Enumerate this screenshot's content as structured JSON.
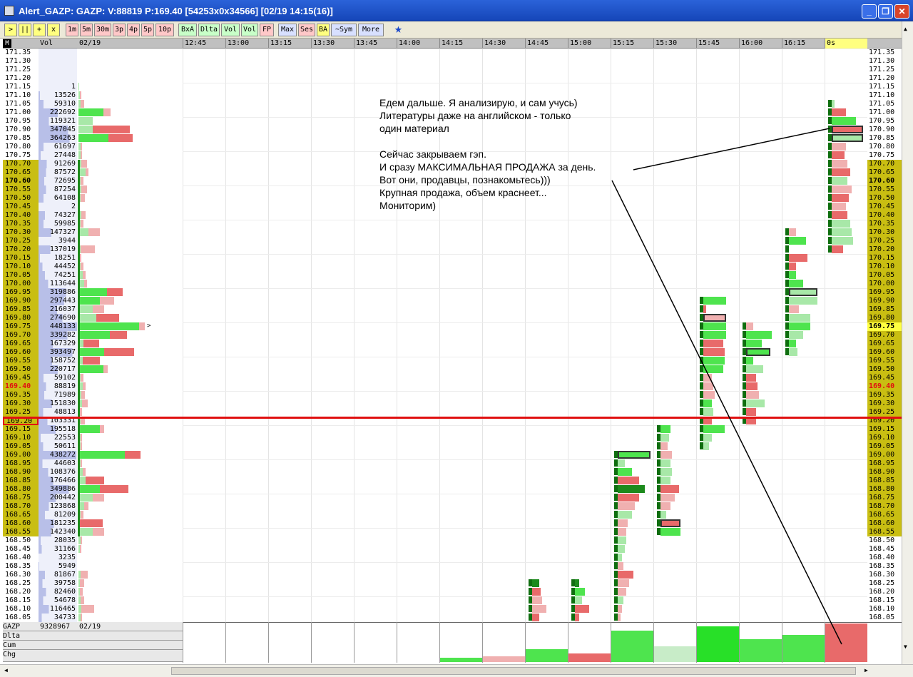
{
  "window": {
    "title": "Alert_GAZP: GAZP: V:88819 P:169.40 [54253x0x34566] [02/19 14:15(16)]",
    "min_label": "_",
    "max_label": "❐",
    "close_label": "✕"
  },
  "toolbar": {
    "buttons": [
      ">",
      "||",
      "+",
      "x",
      "1m",
      "5m",
      "30m",
      "3p",
      "4p",
      "5p",
      "10p",
      "BxA",
      "Dlta",
      "Vol",
      "Vol",
      "FP",
      "Max",
      "Ses",
      "BA",
      "~Sym",
      "More"
    ]
  },
  "left_header": {
    "m": "M",
    "vol": "Vol",
    "date": "02/19"
  },
  "time_labels": [
    "12:45",
    "13:00",
    "13:15",
    "13:30",
    "13:45",
    "14:00",
    "14:15",
    "14:30",
    "14:45",
    "15:00",
    "15:15",
    "15:30",
    "15:45",
    "16:00",
    "16:15",
    "0s"
  ],
  "prices": [
    "171.35",
    "171.30",
    "171.25",
    "171.20",
    "171.15",
    "171.10",
    "171.05",
    "171.00",
    "170.95",
    "170.90",
    "170.85",
    "170.80",
    "170.75",
    "170.70",
    "170.65",
    "170.60",
    "170.55",
    "170.50",
    "170.45",
    "170.40",
    "170.35",
    "170.30",
    "170.25",
    "170.20",
    "170.15",
    "170.10",
    "170.05",
    "170.00",
    "169.95",
    "169.90",
    "169.85",
    "169.80",
    "169.75",
    "169.70",
    "169.65",
    "169.60",
    "169.55",
    "169.50",
    "169.45",
    "169.40",
    "169.35",
    "169.30",
    "169.25",
    "169.20",
    "169.15",
    "169.10",
    "169.05",
    "169.00",
    "168.95",
    "168.90",
    "168.85",
    "168.80",
    "168.75",
    "168.70",
    "168.65",
    "168.60",
    "168.55",
    "168.50",
    "168.45",
    "168.40",
    "168.35",
    "168.30",
    "168.25",
    "168.20",
    "168.15",
    "168.10",
    "168.05"
  ],
  "volumes": [
    "",
    "",
    "",
    "",
    "1",
    "13526",
    "59310",
    "222692",
    "119321",
    "347045",
    "364263",
    "61697",
    "27448",
    "91269",
    "87572",
    "72695",
    "87254",
    "64108",
    "2",
    "74327",
    "59985",
    "147327",
    "3944",
    "137019",
    "18251",
    "44452",
    "74251",
    "113644",
    "319886",
    "297443",
    "216037",
    "274690",
    "448133",
    "339282",
    "167329",
    "393497",
    "158752",
    "220717",
    "59102",
    "88819",
    "71989",
    "151830",
    "48813",
    "103331",
    "195518",
    "22553",
    "50611",
    "438272",
    "44603",
    "108376",
    "176466",
    "349886",
    "200442",
    "123868",
    "81209",
    "181235",
    "142340",
    "28035",
    "31166",
    "3235",
    "5949",
    "81867",
    "39758",
    "82460",
    "54678",
    "116465",
    "34733"
  ],
  "current_price": "169.40",
  "bold_price": "170.60",
  "yellow_price": "169.75",
  "boxed_price": "169.20",
  "profile_marker": ">",
  "bottom": {
    "rows": [
      "GAZP",
      "Dlta",
      "Cum",
      "Chg"
    ],
    "total_volume": "9328967",
    "date": "02/19"
  },
  "annotation": [
    "Едем дальше. Я анализирую, и сам учусь)",
    "Литературы даже на английском - только",
    "один материал",
    "",
    "Сейчас закрываем гэп.",
    "И сразу МАКСИМАЛЬНАЯ ПРОДАЖА за день.",
    "Вот они, продавцы, познакомьтесь)))",
    "Крупная продажа, объем краснеет...",
    "Мониторим)"
  ],
  "colors": {
    "buy": "#4ee44e",
    "sell": "#e86a6a",
    "buy_light": "#a8e8a8",
    "sell_light": "#f0b0b0",
    "value_area": "#c9be12",
    "line": "#e01010"
  },
  "profile_pairs": [
    [
      0,
      0
    ],
    [
      0,
      0
    ],
    [
      0,
      0
    ],
    [
      0,
      0
    ],
    [
      1,
      0
    ],
    [
      2,
      2
    ],
    [
      3,
      5
    ],
    [
      35,
      10
    ],
    [
      20,
      0
    ],
    [
      20,
      52
    ],
    [
      42,
      34
    ],
    [
      3,
      2
    ],
    [
      3,
      2
    ],
    [
      4,
      8
    ],
    [
      10,
      4
    ],
    [
      3,
      4
    ],
    [
      4,
      8
    ],
    [
      3,
      6
    ],
    [
      0,
      0
    ],
    [
      4,
      6
    ],
    [
      3,
      4
    ],
    [
      14,
      16
    ],
    [
      0,
      2
    ],
    [
      3,
      20
    ],
    [
      2,
      2
    ],
    [
      3,
      4
    ],
    [
      6,
      4
    ],
    [
      8,
      4
    ],
    [
      40,
      22
    ],
    [
      30,
      20
    ],
    [
      20,
      16
    ],
    [
      25,
      32
    ],
    [
      85,
      8
    ],
    [
      44,
      24
    ],
    [
      7,
      22
    ],
    [
      36,
      42
    ],
    [
      6,
      24
    ],
    [
      35,
      6
    ],
    [
      3,
      4
    ],
    [
      6,
      4
    ],
    [
      4,
      5
    ],
    [
      5,
      8
    ],
    [
      2,
      3
    ],
    [
      3,
      6
    ],
    [
      30,
      6
    ],
    [
      3,
      2
    ],
    [
      3,
      2
    ],
    [
      65,
      22
    ],
    [
      3,
      2
    ],
    [
      6,
      4
    ],
    [
      10,
      26
    ],
    [
      30,
      40
    ],
    [
      20,
      16
    ],
    [
      8,
      6
    ],
    [
      3,
      4
    ],
    [
      2,
      32
    ],
    [
      20,
      16
    ],
    [
      3,
      2
    ],
    [
      2,
      2
    ],
    [
      0,
      0
    ],
    [
      0,
      0
    ],
    [
      3,
      10
    ],
    [
      2,
      6
    ],
    [
      2,
      4
    ],
    [
      3,
      5
    ],
    [
      4,
      18
    ],
    [
      3,
      2
    ]
  ],
  "candles": [
    {
      "c": 8,
      "cells": [
        [
          62,
          "bl",
          10
        ],
        [
          63,
          "s",
          12
        ],
        [
          64,
          "sl",
          14
        ],
        [
          65,
          "sl",
          20
        ],
        [
          66,
          "s",
          10
        ]
      ]
    },
    {
      "c": 9,
      "cells": [
        [
          62,
          "bl",
          6
        ],
        [
          63,
          "g",
          14
        ],
        [
          64,
          "gl",
          10
        ],
        [
          65,
          "s",
          20
        ],
        [
          66,
          "s",
          6
        ]
      ]
    },
    {
      "c": 10,
      "cells": [
        [
          47,
          "g",
          46
        ],
        [
          48,
          "gl",
          10
        ],
        [
          49,
          "g",
          20
        ],
        [
          50,
          "s",
          30
        ],
        [
          51,
          "bl",
          38
        ],
        [
          52,
          "s",
          30
        ],
        [
          53,
          "sl",
          24
        ],
        [
          54,
          "gl",
          20
        ],
        [
          55,
          "sl",
          14
        ],
        [
          56,
          "sl",
          12
        ],
        [
          57,
          "gl",
          12
        ],
        [
          58,
          "gl",
          10
        ],
        [
          59,
          "gl",
          6
        ],
        [
          60,
          "sl",
          8
        ],
        [
          61,
          "s",
          22
        ],
        [
          62,
          "sl",
          16
        ],
        [
          63,
          "sl",
          12
        ],
        [
          64,
          "gl",
          8
        ],
        [
          65,
          "sl",
          6
        ],
        [
          66,
          "sl",
          4
        ]
      ]
    },
    {
      "c": 11,
      "cells": [
        [
          44,
          "g",
          14
        ],
        [
          45,
          "gl",
          12
        ],
        [
          46,
          "sl",
          10
        ],
        [
          47,
          "sl",
          16
        ],
        [
          48,
          "gl",
          14
        ],
        [
          49,
          "gl",
          16
        ],
        [
          50,
          "gl",
          14
        ],
        [
          51,
          "s",
          26
        ],
        [
          52,
          "sl",
          20
        ],
        [
          53,
          "sl",
          14
        ],
        [
          54,
          "gl",
          8
        ],
        [
          55,
          "s",
          28
        ],
        [
          56,
          "g",
          28
        ]
      ]
    },
    {
      "c": 12,
      "cells": [
        [
          29,
          "g",
          32
        ],
        [
          30,
          "s",
          4
        ],
        [
          31,
          "sl",
          32
        ],
        [
          32,
          "g",
          32
        ],
        [
          33,
          "g",
          32
        ],
        [
          34,
          "s",
          28
        ],
        [
          35,
          "s",
          30
        ],
        [
          36,
          "g",
          30
        ],
        [
          37,
          "g",
          28
        ],
        [
          38,
          "sl",
          12
        ],
        [
          39,
          "sl",
          14
        ],
        [
          40,
          "sl",
          16
        ],
        [
          41,
          "g",
          12
        ],
        [
          42,
          "gl",
          14
        ],
        [
          43,
          "s",
          12
        ],
        [
          44,
          "g",
          30
        ],
        [
          45,
          "gl",
          12
        ],
        [
          46,
          "gl",
          8
        ]
      ]
    },
    {
      "c": 13,
      "cells": [
        [
          32,
          "sl",
          10
        ],
        [
          33,
          "g",
          36
        ],
        [
          34,
          "g",
          22
        ],
        [
          35,
          "g",
          34
        ],
        [
          36,
          "g",
          10
        ],
        [
          37,
          "gl",
          24
        ],
        [
          38,
          "s",
          14
        ],
        [
          39,
          "s",
          16
        ],
        [
          40,
          "sl",
          18
        ],
        [
          41,
          "gl",
          26
        ],
        [
          42,
          "s",
          14
        ],
        [
          43,
          "s",
          14
        ]
      ]
    },
    {
      "c": 14,
      "cells": [
        [
          21,
          "sl",
          10
        ],
        [
          22,
          "g",
          24
        ],
        [
          24,
          "s",
          26
        ],
        [
          25,
          "s",
          10
        ],
        [
          26,
          "g",
          10
        ],
        [
          27,
          "g",
          20
        ],
        [
          28,
          "g",
          24
        ],
        [
          29,
          "gl",
          40
        ],
        [
          30,
          "sl",
          14
        ],
        [
          31,
          "gl",
          30
        ],
        [
          32,
          "g",
          30
        ],
        [
          33,
          "gl",
          20
        ],
        [
          34,
          "g",
          10
        ],
        [
          35,
          "gl",
          12
        ]
      ]
    },
    {
      "c": 15,
      "cells": [
        [
          9,
          "sl",
          20
        ],
        [
          10,
          "s",
          44
        ],
        [
          11,
          "sl",
          20
        ],
        [
          12,
          "s",
          18
        ],
        [
          13,
          "sl",
          22
        ],
        [
          14,
          "s",
          26
        ],
        [
          15,
          "gl",
          22
        ],
        [
          16,
          "sl",
          28
        ],
        [
          17,
          "s",
          24
        ],
        [
          18,
          "sl",
          20
        ],
        [
          19,
          "s",
          22
        ],
        [
          20,
          "gl",
          26
        ],
        [
          21,
          "gl",
          28
        ],
        [
          22,
          "gl",
          30
        ],
        [
          23,
          "s",
          16
        ],
        [
          6,
          "gl",
          4
        ],
        [
          7,
          "s",
          20
        ],
        [
          8,
          "g",
          34
        ]
      ]
    }
  ],
  "bottom_bars": [
    {
      "c": 6,
      "h": 6,
      "k": "g"
    },
    {
      "c": 7,
      "h": 8,
      "k": "sl"
    },
    {
      "c": 8,
      "h": 18,
      "k": "g"
    },
    {
      "c": 9,
      "h": 12,
      "k": "s"
    },
    {
      "c": 10,
      "h": 44,
      "k": "g"
    },
    {
      "c": 11,
      "h": 22,
      "k": "gl"
    },
    {
      "c": 12,
      "h": 50,
      "k": "G"
    },
    {
      "c": 13,
      "h": 32,
      "k": "g"
    },
    {
      "c": 14,
      "h": 38,
      "k": "g"
    },
    {
      "c": 15,
      "h": 54,
      "k": "s"
    }
  ]
}
